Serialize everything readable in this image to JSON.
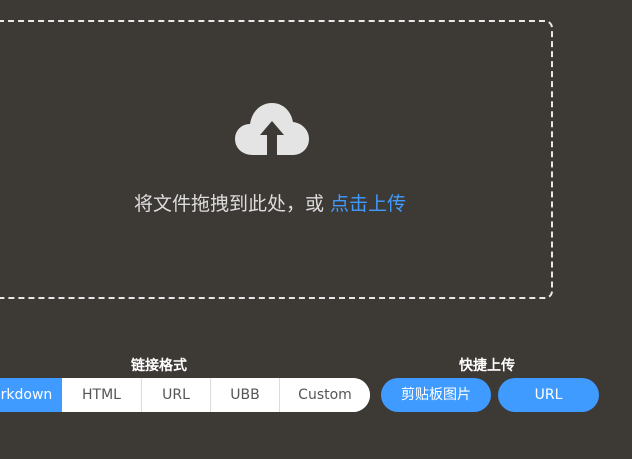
{
  "dropzone": {
    "text": "将文件拖拽到此处，或 ",
    "link": "点击上传",
    "icon": "cloud-upload-icon"
  },
  "link_format": {
    "title": "链接格式",
    "options": [
      "Markdown",
      "HTML",
      "URL",
      "UBB",
      "Custom"
    ],
    "selected": "Markdown"
  },
  "quick_upload": {
    "title": "快捷上传",
    "paste_label": "剪贴板图片",
    "url_label": "URL"
  },
  "colors": {
    "background": "#3d3935",
    "accent": "#3f9bff",
    "border": "#e9e9e9"
  }
}
